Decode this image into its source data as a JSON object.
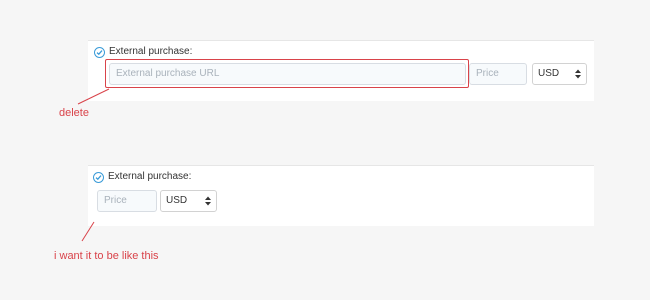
{
  "top_example": {
    "checkbox_icon": "check-circle-icon",
    "label": "External purchase:",
    "url_placeholder": "External purchase URL",
    "price_placeholder": "Price",
    "currency_selected": "USD",
    "annotation": "delete"
  },
  "bottom_example": {
    "checkbox_icon": "check-circle-icon",
    "label": "External purchase:",
    "price_placeholder": "Price",
    "currency_selected": "USD",
    "annotation": "i want it to be like this"
  },
  "colors": {
    "annotation": "#d9434a",
    "check": "#3a9bd8"
  }
}
